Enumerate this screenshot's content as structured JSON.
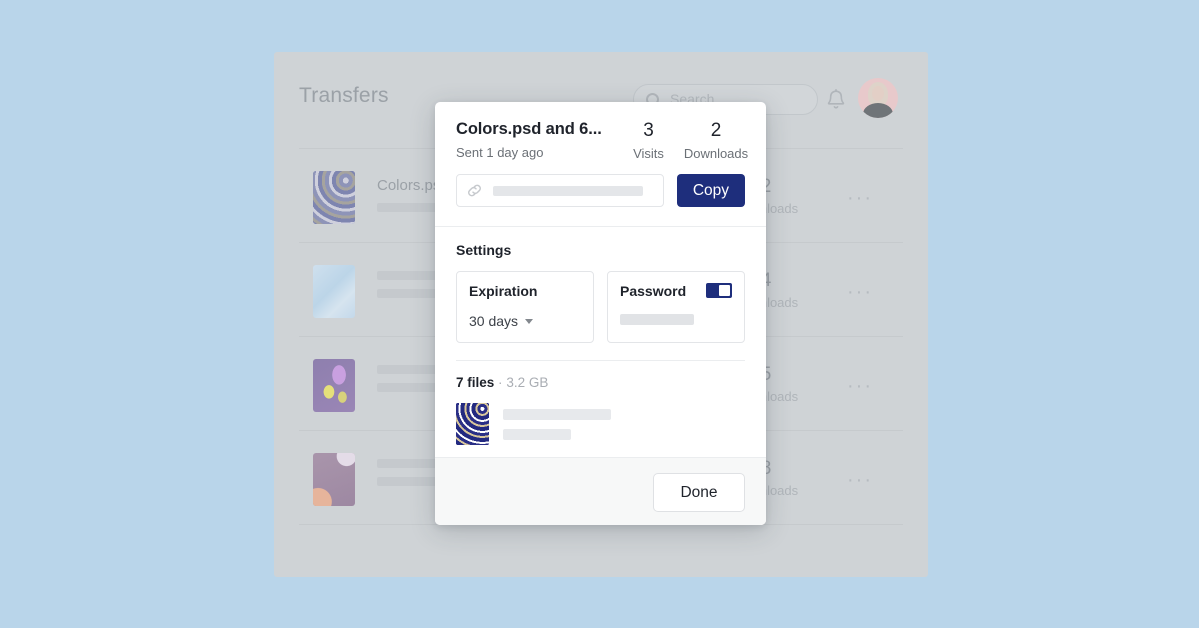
{
  "app": {
    "title": "Transfers",
    "search": {
      "placeholder": "Search"
    },
    "icons": {
      "bell": "bell-icon",
      "search": "search-icon",
      "avatar": "avatar"
    },
    "rows": [
      {
        "name": "Colors.ps",
        "downloads": "2",
        "downloads_label": "Downloads",
        "more": "···",
        "art": "art-fingerprint"
      },
      {
        "name": "",
        "downloads": "4",
        "downloads_label": "Downloads",
        "more": "···",
        "art": "art-soft-blue"
      },
      {
        "name": "",
        "downloads": "5",
        "downloads_label": "Downloads",
        "more": "···",
        "art": "art-purple-yellow"
      },
      {
        "name": "",
        "downloads": "8",
        "downloads_label": "Downloads",
        "more": "···",
        "art": "art-mauve"
      }
    ]
  },
  "modal": {
    "title": "Colors.psd and 6...",
    "subtitle": "Sent 1 day ago",
    "stats": {
      "visits_value": "3",
      "visits_label": "Visits",
      "downloads_value": "2",
      "downloads_label": "Downloads"
    },
    "link": {
      "icon": "link-icon",
      "value": ""
    },
    "copy_label": "Copy",
    "settings": {
      "heading": "Settings",
      "expiration": {
        "label": "Expiration",
        "value": "30 days"
      },
      "password": {
        "label": "Password",
        "enabled": true,
        "masked_value": ""
      }
    },
    "files": {
      "count_label": "7 files",
      "separator": "·",
      "size_label": "3.2 GB",
      "items": [
        {
          "name": "",
          "meta": "",
          "art": "art-fingerprint-vivid"
        }
      ]
    },
    "done_label": "Done"
  },
  "colors": {
    "page_background": "#b9d5ea",
    "panel_background": "#cfd3d6",
    "accent": "#1e2e7c",
    "modal_background": "#ffffff",
    "footer_background": "#f7f8f8"
  }
}
